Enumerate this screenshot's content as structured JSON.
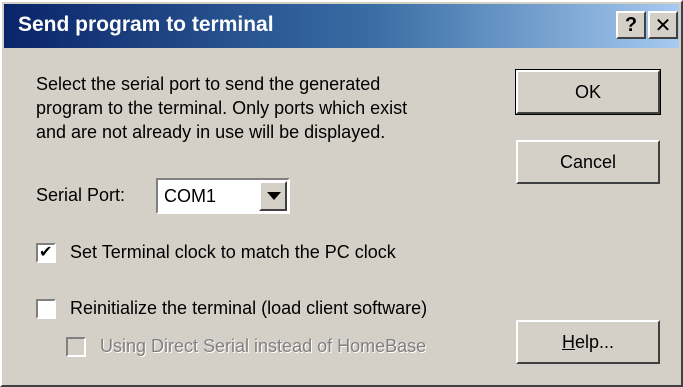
{
  "window": {
    "title": "Send program to terminal",
    "help_glyph": "?",
    "close_glyph": "✕"
  },
  "description": "Select the serial port to send the generated\nprogram to the terminal.  Only ports which exist\nand are not already in use will be displayed.",
  "serial_port": {
    "label": "Serial Port:",
    "value": "COM1"
  },
  "checkboxes": [
    {
      "label": "Set Terminal clock to match the PC clock",
      "checked": true,
      "enabled": true
    },
    {
      "label": "Reinitialize the terminal (load client software)",
      "checked": false,
      "enabled": true
    },
    {
      "label": "Using Direct Serial instead of HomeBase",
      "checked": false,
      "enabled": false
    }
  ],
  "buttons": {
    "ok": "OK",
    "cancel": "Cancel",
    "help": "Help..."
  },
  "icons": {
    "help": "help-question-icon",
    "close": "close-x-icon",
    "dropdown": "chevron-down-icon",
    "check": "checkmark-icon"
  }
}
